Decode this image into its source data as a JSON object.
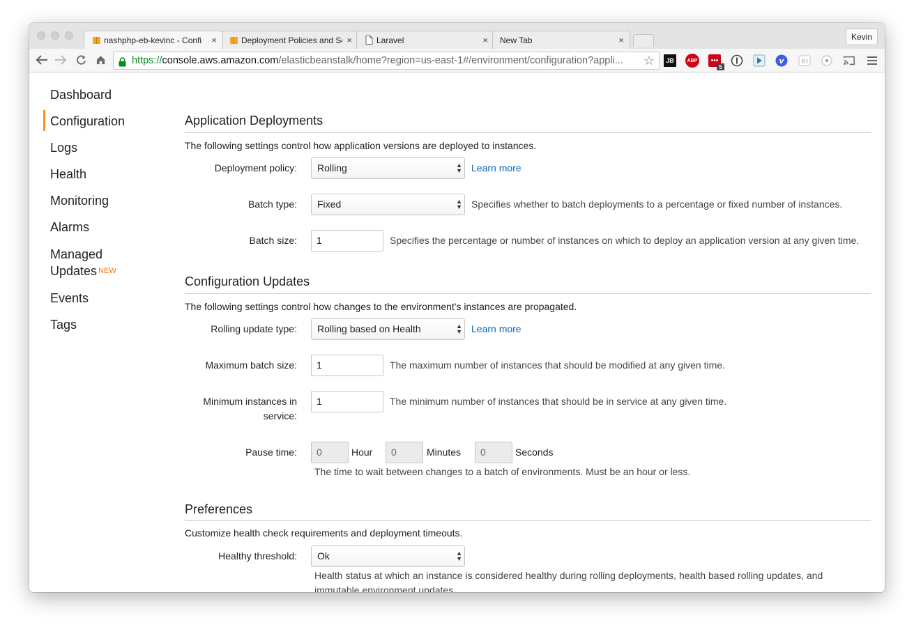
{
  "browser": {
    "tabs": [
      {
        "title": "nashphp-eb-kevinc - Confi",
        "favicon": "aws-box-icon"
      },
      {
        "title": "Deployment Policies and Se",
        "favicon": "aws-box-icon"
      },
      {
        "title": "Laravel",
        "favicon": "page-icon"
      },
      {
        "title": "New Tab",
        "favicon": ""
      }
    ],
    "close_glyph": "×",
    "profile": "Kevin",
    "url_scheme": "https://",
    "url_host": "console.aws.amazon.com",
    "url_path": "/elasticbeanstalk/home?region=us-east-1#/environment/configuration?appli...",
    "extensions": {
      "jetbrains": "JB",
      "adblock": "ABP",
      "lastpass_badge": "5"
    }
  },
  "sidebar": {
    "items": [
      {
        "label": "Dashboard"
      },
      {
        "label": "Configuration",
        "active": true
      },
      {
        "label": "Logs"
      },
      {
        "label": "Health"
      },
      {
        "label": "Monitoring"
      },
      {
        "label": "Alarms"
      },
      {
        "label_line1": "Managed",
        "label_line2": "Updates",
        "badge": "NEW"
      },
      {
        "label": "Events"
      },
      {
        "label": "Tags"
      }
    ]
  },
  "deployments": {
    "title": "Application Deployments",
    "description": "The following settings control how application versions are deployed to instances.",
    "policy_label": "Deployment policy:",
    "policy_value": "Rolling",
    "policy_link": "Learn more",
    "batch_type_label": "Batch type:",
    "batch_type_value": "Fixed",
    "batch_type_help": "Specifies whether to batch deployments to a percentage or fixed number of instances.",
    "batch_size_label": "Batch size:",
    "batch_size_value": "1",
    "batch_size_help": "Specifies the percentage or number of instances on which to deploy an application version at any given time."
  },
  "updates": {
    "title": "Configuration Updates",
    "description": "The following settings control how changes to the environment's instances are propagated.",
    "rolling_label": "Rolling update type:",
    "rolling_value": "Rolling based on Health",
    "rolling_link": "Learn more",
    "max_batch_label": "Maximum batch size:",
    "max_batch_value": "1",
    "max_batch_help": "The maximum number of instances that should be modified at any given time.",
    "min_inst_label_line1": "Minimum instances in",
    "min_inst_label_line2": "service:",
    "min_inst_value": "1",
    "min_inst_help": "The minimum number of instances that should be in service at any given time.",
    "pause_label": "Pause time:",
    "pause_hour": "0",
    "pause_hour_unit": "Hour",
    "pause_minutes": "0",
    "pause_minutes_unit": "Minutes",
    "pause_seconds": "0",
    "pause_seconds_unit": "Seconds",
    "pause_help": "The time to wait between changes to a batch of environments. Must be an hour or less."
  },
  "preferences": {
    "title": "Preferences",
    "description": "Customize health check requirements and deployment timeouts.",
    "threshold_label": "Healthy threshold:",
    "threshold_value": "Ok",
    "threshold_help_line1": "Health status at which an instance is considered healthy during rolling deployments, health based rolling updates, and",
    "threshold_help_line2": "immutable environment updates."
  },
  "colors": {
    "accent": "#f7911f",
    "new_badge": "#ec7211",
    "link": "#0066c0",
    "url_scheme": "#0b8a1f"
  }
}
